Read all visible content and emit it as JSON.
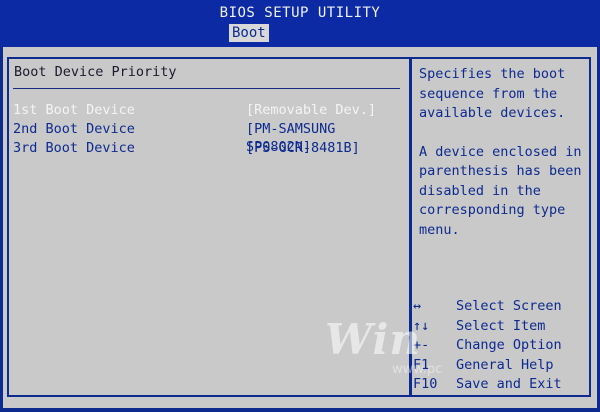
{
  "header": {
    "title": "BIOS SETUP UTILITY",
    "active_tab": "Boot"
  },
  "main": {
    "section_title": "Boot Device Priority",
    "rows": [
      {
        "label": "1st Boot Device",
        "value": "[Removable Dev.]",
        "selected": true
      },
      {
        "label": "2nd Boot Device",
        "value": "[PM-SAMSUNG SP0802N]",
        "selected": false
      },
      {
        "label": "3rd Boot Device",
        "value": "[PS-GCR-8481B]",
        "selected": false
      }
    ]
  },
  "help": {
    "lines_1": [
      "Specifies the boot",
      "sequence from the",
      "available devices."
    ],
    "lines_2": [
      "A device enclosed in",
      "parenthesis has been",
      "disabled in the",
      "corresponding type",
      "menu."
    ]
  },
  "keys": [
    {
      "key": "↔",
      "action": "Select Screen"
    },
    {
      "key": "↑↓",
      "action": "Select Item"
    },
    {
      "key": "+-",
      "action": "Change Option"
    },
    {
      "key": "F1",
      "action": "General Help"
    },
    {
      "key": "F10",
      "action": "Save and Exit"
    }
  ],
  "watermark": {
    "text": "Win",
    "sub": "www.pc"
  },
  "colors": {
    "background_blue": "#0d2a8f",
    "panel_gray": "#c9c9c9",
    "selected_text": "#f4f4f4"
  }
}
